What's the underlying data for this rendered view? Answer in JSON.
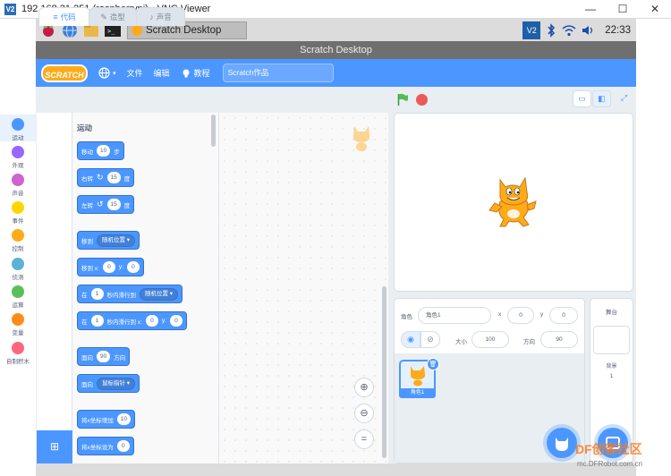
{
  "vnc": {
    "logo": "V2",
    "title": "192.168.31.251 (raspberrypi) - VNC Viewer",
    "controls": [
      "—",
      "☐",
      "✕"
    ]
  },
  "taskbar": {
    "task_label": "Scratch Desktop",
    "clock": "22:33",
    "vnc_tray_label": "V2"
  },
  "scratch": {
    "window_title": "Scratch Desktop",
    "logo_text": "SCRATCH",
    "menu": {
      "file": "文件",
      "edit": "编辑",
      "tutorials": "教程"
    },
    "project_title": "Scratch作品",
    "tabs": {
      "code": "代码",
      "costumes": "造型",
      "sounds": "声音"
    }
  },
  "categories": [
    {
      "label": "运动",
      "color": "#4c97ff"
    },
    {
      "label": "外观",
      "color": "#9966ff"
    },
    {
      "label": "声音",
      "color": "#cf63cf"
    },
    {
      "label": "事件",
      "color": "#ffd500"
    },
    {
      "label": "控制",
      "color": "#ffab19"
    },
    {
      "label": "侦测",
      "color": "#5cb1d6"
    },
    {
      "label": "运算",
      "color": "#59c059"
    },
    {
      "label": "变量",
      "color": "#ff8c1a"
    },
    {
      "label": "自制积木",
      "color": "#ff6680"
    }
  ],
  "palette": {
    "heading": "运动",
    "move": {
      "a": "移动",
      "v": "10",
      "b": "步"
    },
    "turn_right": {
      "a": "右转",
      "v": "15",
      "b": "度"
    },
    "turn_left": {
      "a": "左转",
      "v": "15",
      "b": "度"
    },
    "goto": {
      "a": "移到",
      "dd": "随机位置"
    },
    "goto_xy": {
      "a": "移到 x:",
      "x": "0",
      "b": "y:",
      "y": "0"
    },
    "glide": {
      "a": "在",
      "v": "1",
      "b": "秒内滑行到",
      "dd": "随机位置"
    },
    "glide_xy": {
      "a": "在",
      "v": "1",
      "b": "秒内滑行到 x:",
      "x": "0",
      "c": "y:",
      "y": "0"
    },
    "point": {
      "a": "面向",
      "v": "90",
      "b": "方向"
    },
    "point_towards": {
      "a": "面向",
      "dd": "鼠标指针"
    },
    "change_x": {
      "a": "将x坐标增加",
      "v": "10"
    },
    "set_x": {
      "a": "将x坐标设为",
      "v": "0"
    }
  },
  "sprite_info": {
    "sprite_label": "角色",
    "sprite_name": "角色1",
    "x_label": "x",
    "x": "0",
    "y_label": "y",
    "y": "0",
    "show_label": "显示",
    "size_label": "大小",
    "size": "100",
    "direction_label": "方向",
    "direction": "90",
    "thumb_name": "角色1"
  },
  "stage_pane": {
    "title": "舞台",
    "backdrops_label": "背景",
    "backdrops_count": "1"
  },
  "watermark": {
    "brand": "DF创客社区",
    "url": "mc.DFRobot.com.cn"
  },
  "host": {
    "side_fragment": "vnc"
  },
  "colors": {
    "scratch_blue": "#4c97ff",
    "motion_block": "#4c97ff",
    "stop": "#ec5959",
    "flag": "#4cbf56"
  }
}
